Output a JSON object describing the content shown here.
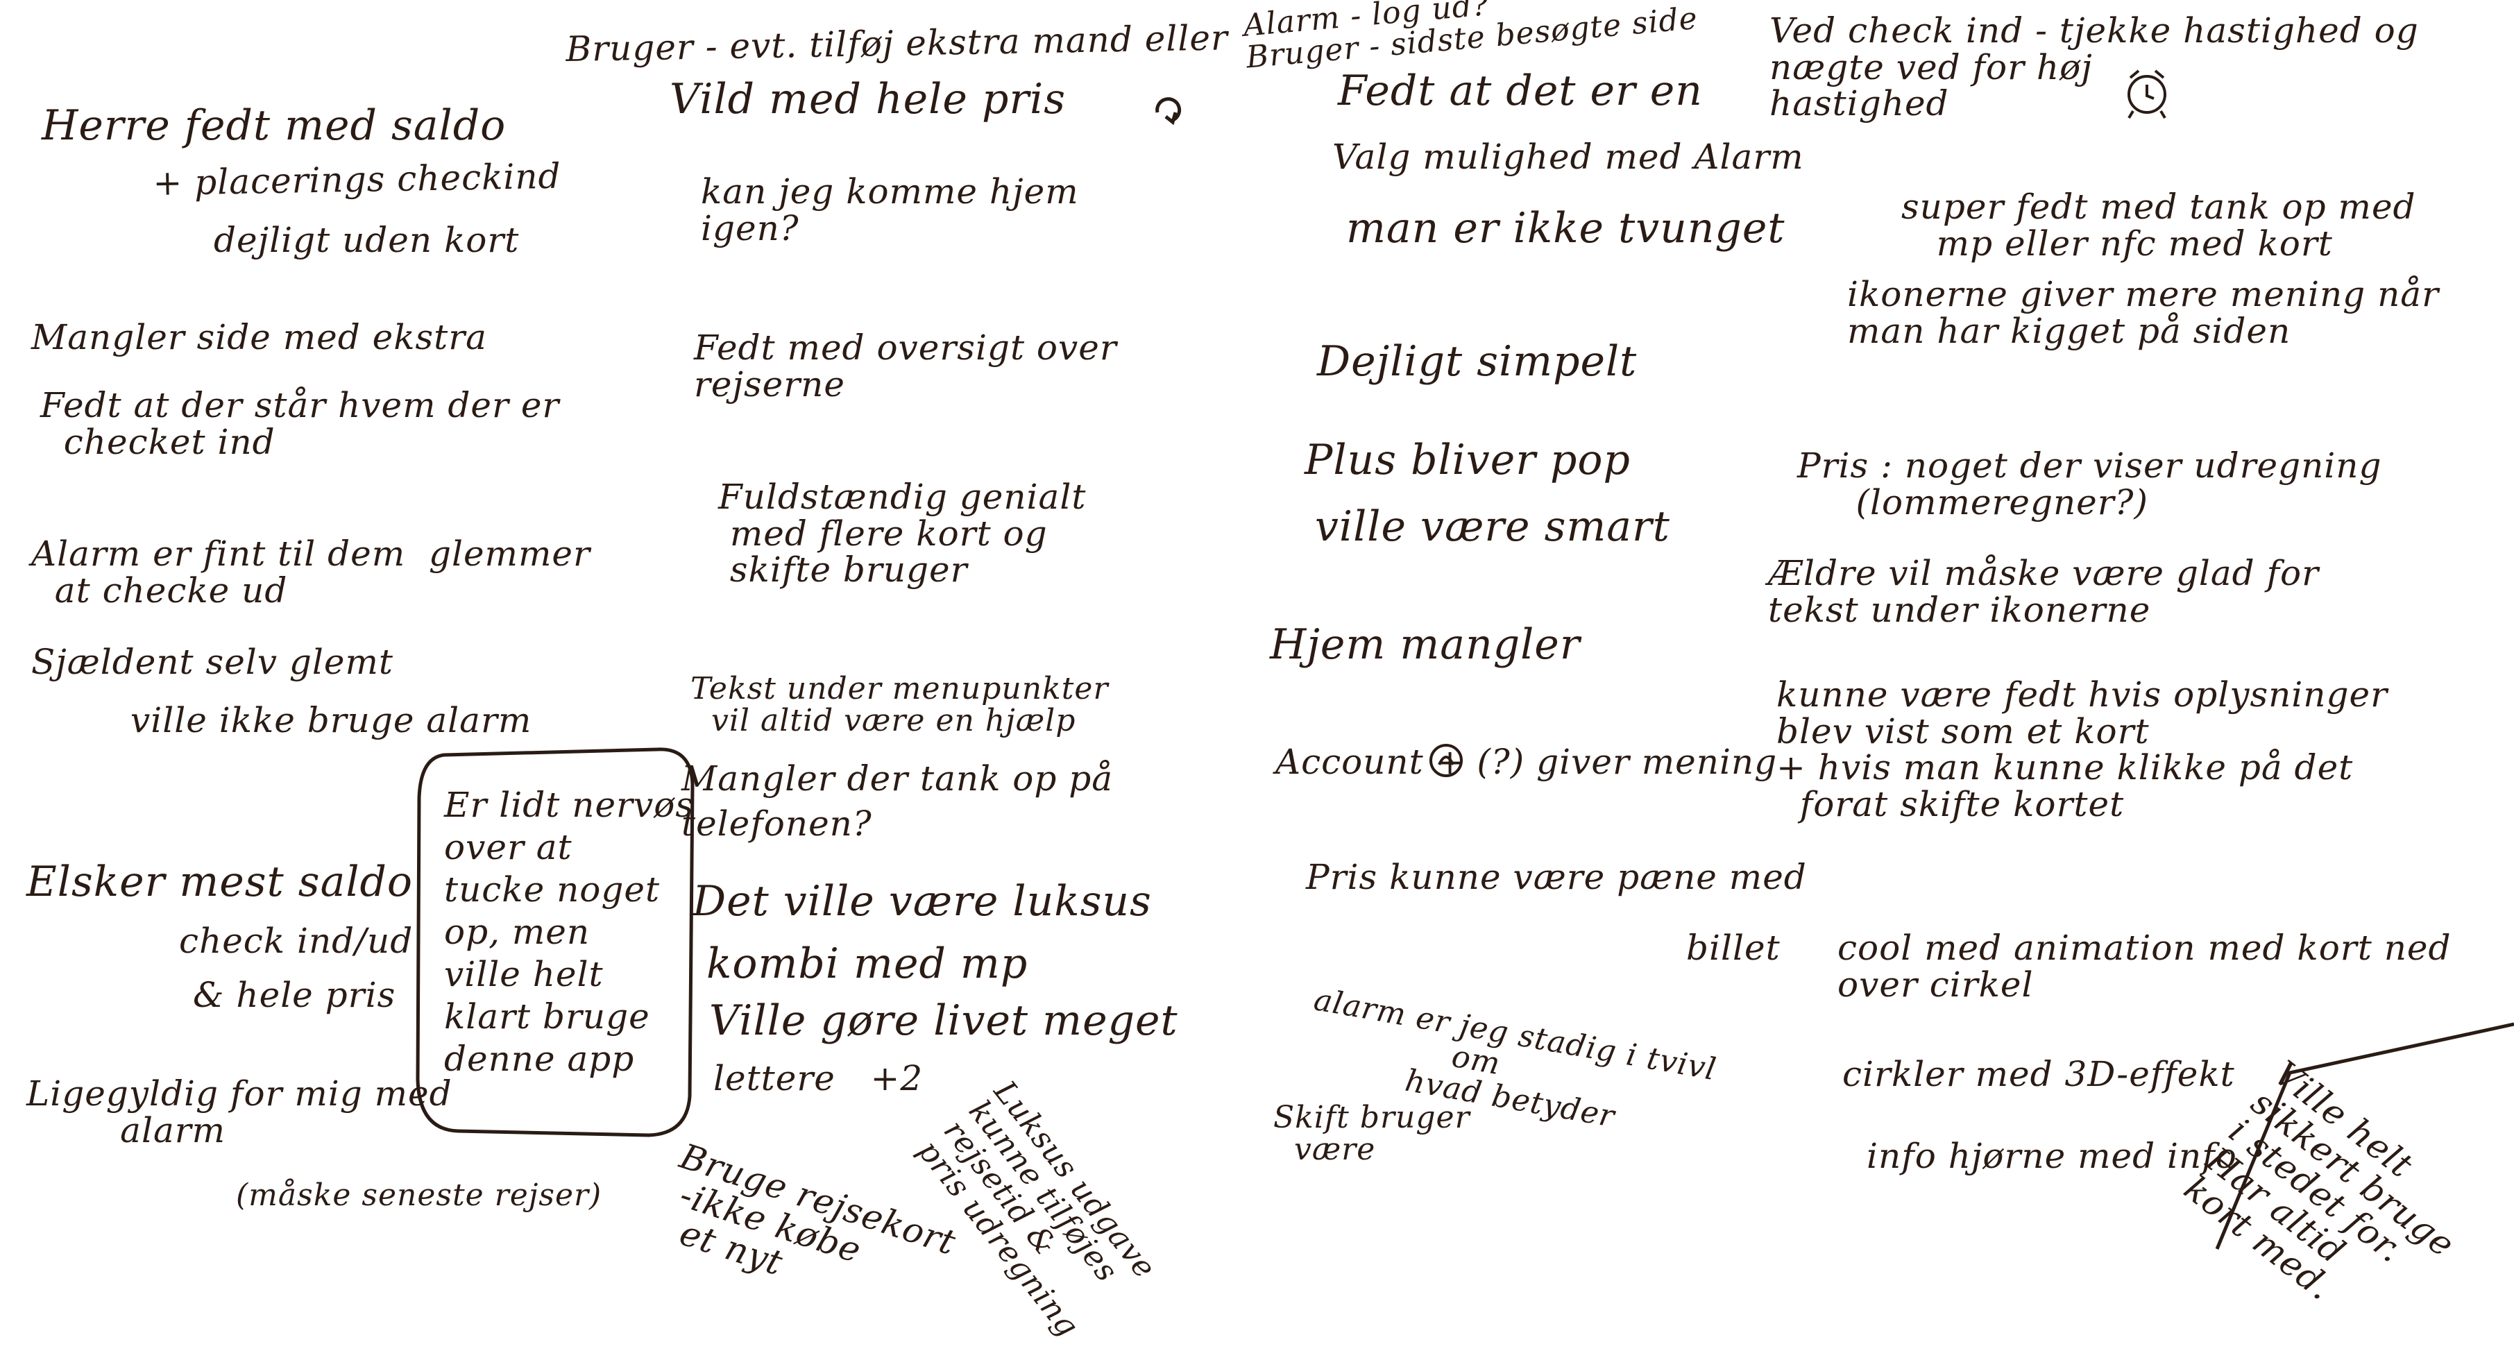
{
  "left_page": {
    "n1": "Herre fedt med saldo",
    "n2": "+ placerings checkind",
    "n3": "dejligt uden kort",
    "n4": "Mangler side med ekstra",
    "n5": "Fedt at der står hvem der er\n  checket ind",
    "n6": "Alarm er fint til dem  glemmer\n  at checke ud",
    "n7": "Sjældent selv glemt",
    "n8": "ville ikke bruge alarm",
    "n9": "Elsker mest saldo",
    "n10": "check ind/ud",
    "n11": "& hele pris",
    "n12": "Ligegyldig for mig med\n        alarm",
    "n13": "(måske seneste rejser)",
    "n14": "Er lidt nervøs\nover at\ntucke noget\nop, men\nville helt\nklart bruge\ndenne app",
    "n15": "Bruger - evt. tilføj ekstra mand eller",
    "n16": "Vild med hele pris",
    "n17": "kan jeg komme hjem\nigen?",
    "n18": "Fedt med oversigt over\nrejserne",
    "n19": "Fuldstændig genialt\n med flere kort og\n skifte bruger",
    "n20": "Tekst under menupunkter\n  vil altid være en hjælp",
    "n21": "Mangler der tank op på\ntelefonen?",
    "n22": "Det ville være luksus",
    "n23": "kombi med mp",
    "n24": "Ville gøre livet meget",
    "n25": "lettere   +2",
    "n26": "Bruge rejsekort\n -ikke købe\n  et nyt",
    "n27": "Luksus udgave\nkunne tilføjes\nrejsetid &\npris udregning"
  },
  "right_page": {
    "r1": "Alarm - log ud?\nBruger - sidste besøgte side",
    "r2": "Fedt at det er en",
    "r3": "Valg mulighed med Alarm",
    "r4": "man er ikke tvunget",
    "r5": "Dejligt simpelt",
    "r6": "Plus bliver pop",
    "r7": "ville være smart",
    "r8": "Hjem mangler",
    "r9": "Account + (?) giver mening",
    "r10": "Pris kunne være pæne med",
    "r11": "billet",
    "r12": "alarm er jeg stadig i tvivl\n              om\n          hvad betyder",
    "r13": "Skift bruger\n  være",
    "r14": "Ved check ind - tjekke hastighed og\nnægte ved for høj\nhastighed",
    "r15": "super fedt med tank op med\n   mp eller nfc med kort",
    "r16": "ikonerne giver mere mening når\nman har kigget på siden",
    "r17": "Pris : noget der viser udregning\n     (lommeregner?)",
    "r18": "Ældre vil måske være glad for\ntekst under ikonerne",
    "r19": "kunne være fedt hvis oplysninger\nblev vist som et kort\n+ hvis man kunne klikke på det\n  forat skifte kortet",
    "r20": "cool med animation med kort ned\nover cirkel",
    "r21": "cirkler med 3D-effekt",
    "r22": "info hjørne med info",
    "r23": "Ville helt\nsikkert bruge\ni stedet for.\nHar altid\nkort med."
  },
  "colors": {
    "ink": "#2a1b14",
    "paper": "#ffffff"
  }
}
